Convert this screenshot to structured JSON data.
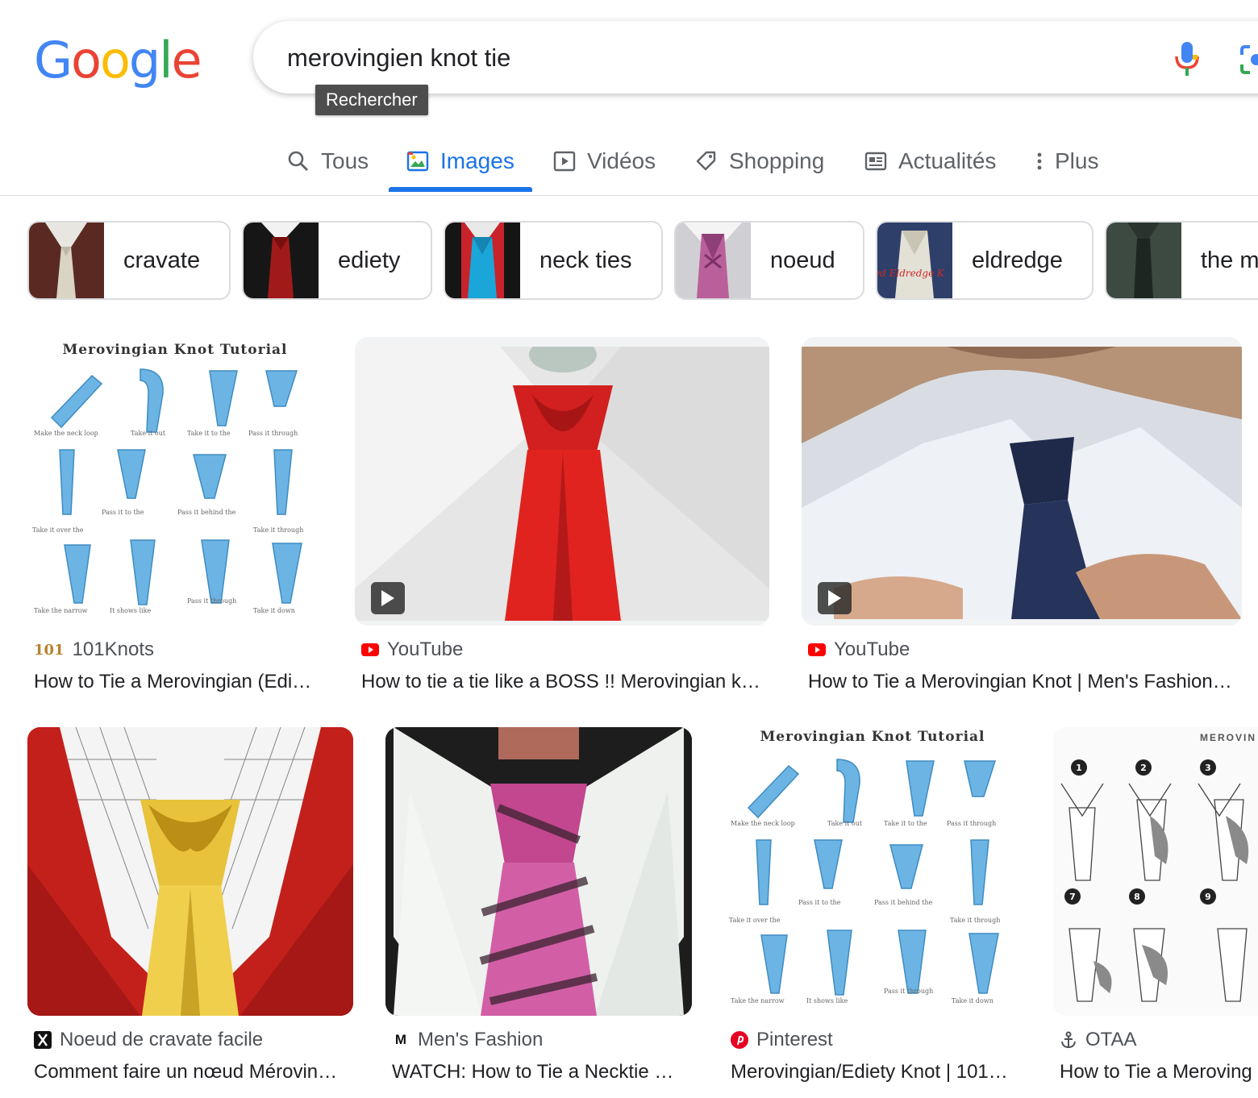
{
  "logo": {
    "letters": [
      "G",
      "o",
      "o",
      "g",
      "l",
      "e"
    ],
    "colors": [
      "#4285F4",
      "#EA4335",
      "#FBBC05",
      "#4285F4",
      "#34A853",
      "#EA4335"
    ]
  },
  "search": {
    "query": "merovingien knot tie",
    "tooltip": "Rechercher"
  },
  "tabs": [
    {
      "label": "Tous",
      "icon": "search-icon"
    },
    {
      "label": "Images",
      "icon": "image-icon",
      "active": true
    },
    {
      "label": "Vidéos",
      "icon": "video-icon"
    },
    {
      "label": "Shopping",
      "icon": "tag-icon"
    },
    {
      "label": "Actualités",
      "icon": "news-icon"
    },
    {
      "label": "Plus",
      "icon": "more-vert-icon"
    }
  ],
  "chips": [
    {
      "label": "cravate"
    },
    {
      "label": "ediety"
    },
    {
      "label": "neck ties"
    },
    {
      "label": "noeud"
    },
    {
      "label": "eldredge",
      "thumb_text": "ed Eldredge K"
    },
    {
      "label": "the m"
    }
  ],
  "results": [
    {
      "source": "101Knots",
      "favicon_text": "101",
      "title": "How to Tie a Merovingian (Edi…",
      "image_title": "Merovingian Knot Tutorial"
    },
    {
      "source": "YouTube",
      "title": "How to tie a tie like a BOSS !! Merovingian k…",
      "video": true
    },
    {
      "source": "YouTube",
      "title": "How to Tie a Merovingian Knot | Men's Fashion…",
      "video": true
    },
    {
      "source": "Noeud de cravate facile",
      "title": "Comment faire un nœud Mérovin…"
    },
    {
      "source": "Men's Fashion",
      "favicon_text": "M",
      "title": "WATCH: How to Tie a Necktie …"
    },
    {
      "source": "Pinterest",
      "title": "Merovingian/Ediety Knot | 101…",
      "image_title": "Merovingian Knot Tutorial"
    },
    {
      "source": "OTAA",
      "title": "How to Tie a Meroving",
      "image_title": "MEROVIN",
      "steps": [
        "1",
        "2",
        "3",
        "7",
        "8",
        "9"
      ]
    }
  ],
  "colors": {
    "accent": "#1a73e8",
    "youtube": "#ff0000",
    "pinterest": "#e60023"
  }
}
